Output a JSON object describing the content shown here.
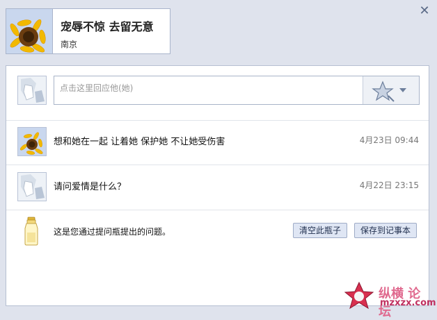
{
  "profile": {
    "name": "宠辱不惊 去留无意",
    "city": "南京"
  },
  "reply": {
    "placeholder": "点击这里回应他(她)"
  },
  "messages": [
    {
      "text": "想和她在一起  让着她  保护她  不让她受伤害",
      "time": "4月23日 09:44"
    },
    {
      "text": "请问爱情是什么？",
      "time": "4月22日 23:15"
    }
  ],
  "bottle": {
    "info": "这是您通过提问瓶提出的问题。",
    "clear_label": "清空此瓶子",
    "save_label": "保存到记事本"
  },
  "watermark": {
    "text": "纵横 论坛",
    "domain": "mzxzx.com"
  },
  "icons": {
    "close": "close-icon",
    "emoji": "star-wand-icon",
    "dropdown": "chevron-down-icon",
    "bottle": "bottle-icon"
  }
}
